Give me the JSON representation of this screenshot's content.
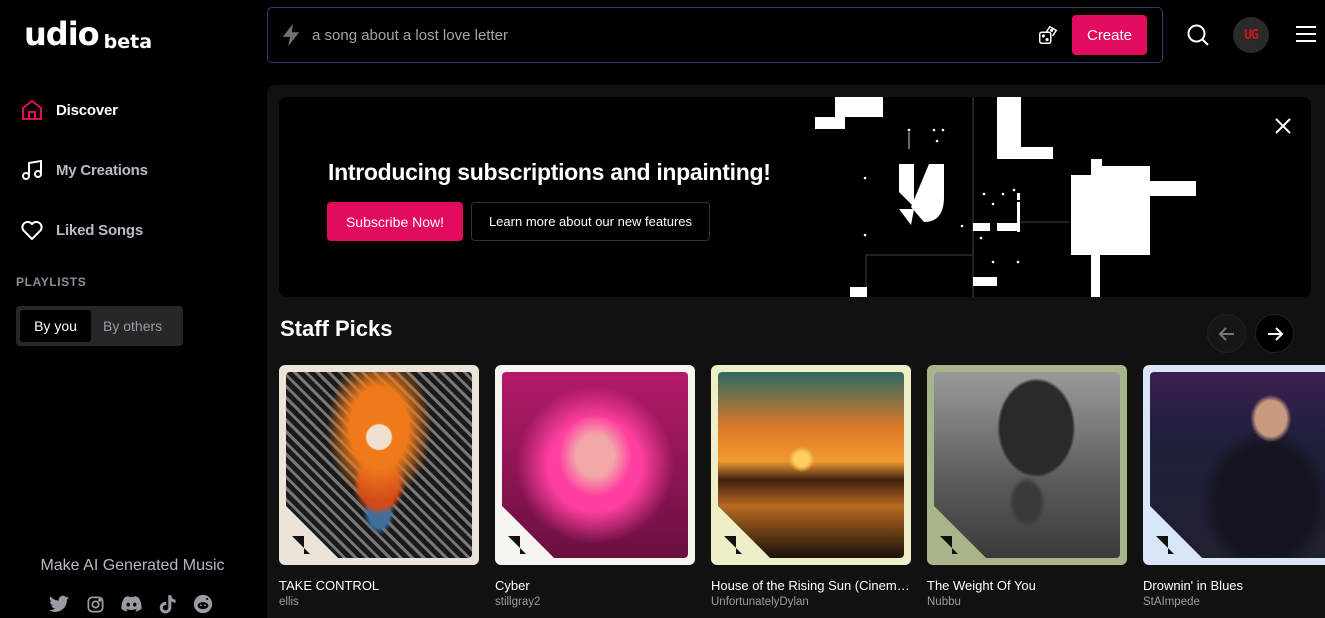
{
  "brand": {
    "name": "udio",
    "tag": "beta"
  },
  "sidebar": {
    "nav": [
      {
        "label": "Discover",
        "icon": "home-icon",
        "active": true
      },
      {
        "label": "My Creations",
        "icon": "music-note-icon",
        "active": false
      },
      {
        "label": "Liked Songs",
        "icon": "heart-icon",
        "active": false
      }
    ],
    "playlists_label": "PLAYLISTS",
    "playlist_tabs": [
      {
        "label": "By you",
        "active": true
      },
      {
        "label": "By others",
        "active": false
      }
    ],
    "tagline": "Make AI Generated Music",
    "socials": [
      "twitter-icon",
      "instagram-icon",
      "discord-icon",
      "tiktok-icon",
      "reddit-icon"
    ]
  },
  "topbar": {
    "prompt_placeholder": "a song about a lost love letter",
    "create_label": "Create",
    "avatar_initials": "UG"
  },
  "banner": {
    "title": "Introducing subscriptions and inpainting!",
    "subscribe_label": "Subscribe Now!",
    "learn_label": "Learn more about our new features"
  },
  "staff_picks": {
    "title": "Staff Picks",
    "items": [
      {
        "title": "TAKE CONTROL",
        "artist": "ellis",
        "frame_color": "#ece3d9"
      },
      {
        "title": "Cyber",
        "artist": "stillgray2",
        "frame_color": "#f7f3ef"
      },
      {
        "title": "House of the Rising Sun (Cinematic)",
        "artist": "UnfortunatelyDylan",
        "frame_color": "#eeefc9"
      },
      {
        "title": "The Weight Of You",
        "artist": "Nubbu",
        "frame_color": "#a8b58a"
      },
      {
        "title": "Drownin' in Blues",
        "artist": "StAImpede",
        "frame_color": "#d8e6f7"
      }
    ]
  },
  "colors": {
    "accent": "#e30b5d",
    "prompt_border": "#2b3d6b"
  }
}
